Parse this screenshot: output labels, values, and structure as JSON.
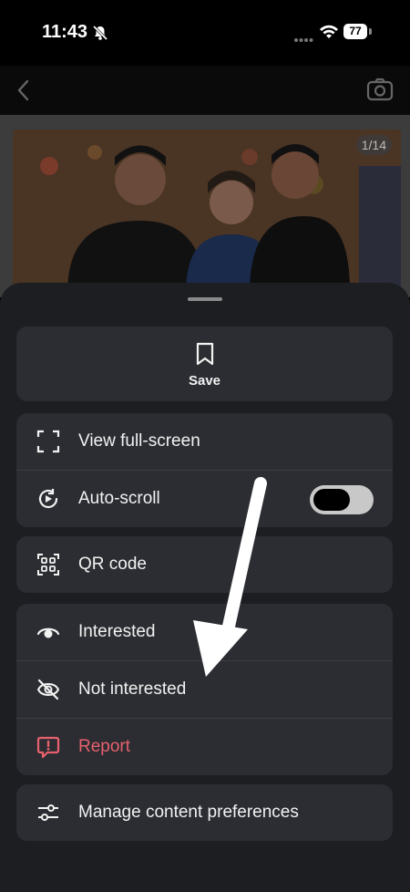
{
  "status": {
    "time": "11:43",
    "battery": "77"
  },
  "photo": {
    "counter": "1/14"
  },
  "sheet": {
    "save_label": "Save",
    "group1": [
      {
        "label": "View full-screen"
      },
      {
        "label": "Auto-scroll"
      }
    ],
    "qr_label": "QR code",
    "group3": [
      {
        "label": "Interested"
      },
      {
        "label": "Not interested"
      },
      {
        "label": "Report"
      }
    ],
    "manage_label": "Manage content preferences"
  },
  "colors": {
    "report": "#e8606d",
    "sheet_bg": "#1c1e22",
    "card_bg": "#2b2d32"
  }
}
